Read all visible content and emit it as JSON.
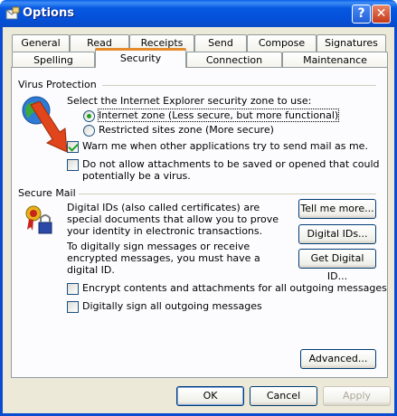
{
  "window": {
    "title": "Options",
    "help_label": "?",
    "close_label": "✕"
  },
  "tabs": {
    "row_top": [
      "General",
      "Read",
      "Receipts",
      "Send",
      "Compose",
      "Signatures"
    ],
    "row_bottom": [
      "Spelling",
      "Security",
      "Connection",
      "Maintenance"
    ],
    "active": "Security"
  },
  "virus": {
    "heading": "Virus Protection",
    "zone_prompt": "Select the Internet Explorer security zone to use:",
    "zone_internet": "Internet zone (Less secure, but more functional)",
    "zone_restricted": "Restricted sites zone (More secure)",
    "warn_label": "Warn me when other applications try to send mail as me.",
    "warn_checked": true,
    "attach_line1": "Do not allow attachments to be saved or opened that could",
    "attach_line2": "potentially be a virus.",
    "attach_checked": false
  },
  "secure_mail": {
    "heading": "Secure Mail",
    "desc": "Digital IDs (also called certificates) are special documents that allow you to prove your identity in electronic transactions.",
    "sign_desc": "To digitally sign messages or receive encrypted messages, you must have a digital ID.",
    "tell_more": "Tell me more...",
    "digital_ids": "Digital IDs...",
    "get_id": "Get Digital ID...",
    "encrypt_label": "Encrypt contents and attachments for all outgoing messages",
    "encrypt_checked": false,
    "sign_label": "Digitally sign all outgoing messages",
    "sign_checked": false,
    "advanced": "Advanced..."
  },
  "footer": {
    "ok": "OK",
    "cancel": "Cancel",
    "apply": "Apply"
  },
  "colors": {
    "titlebar": "#0A5FE8",
    "dialog_bg": "#ECE9D8",
    "arrow": "#E0451B"
  }
}
